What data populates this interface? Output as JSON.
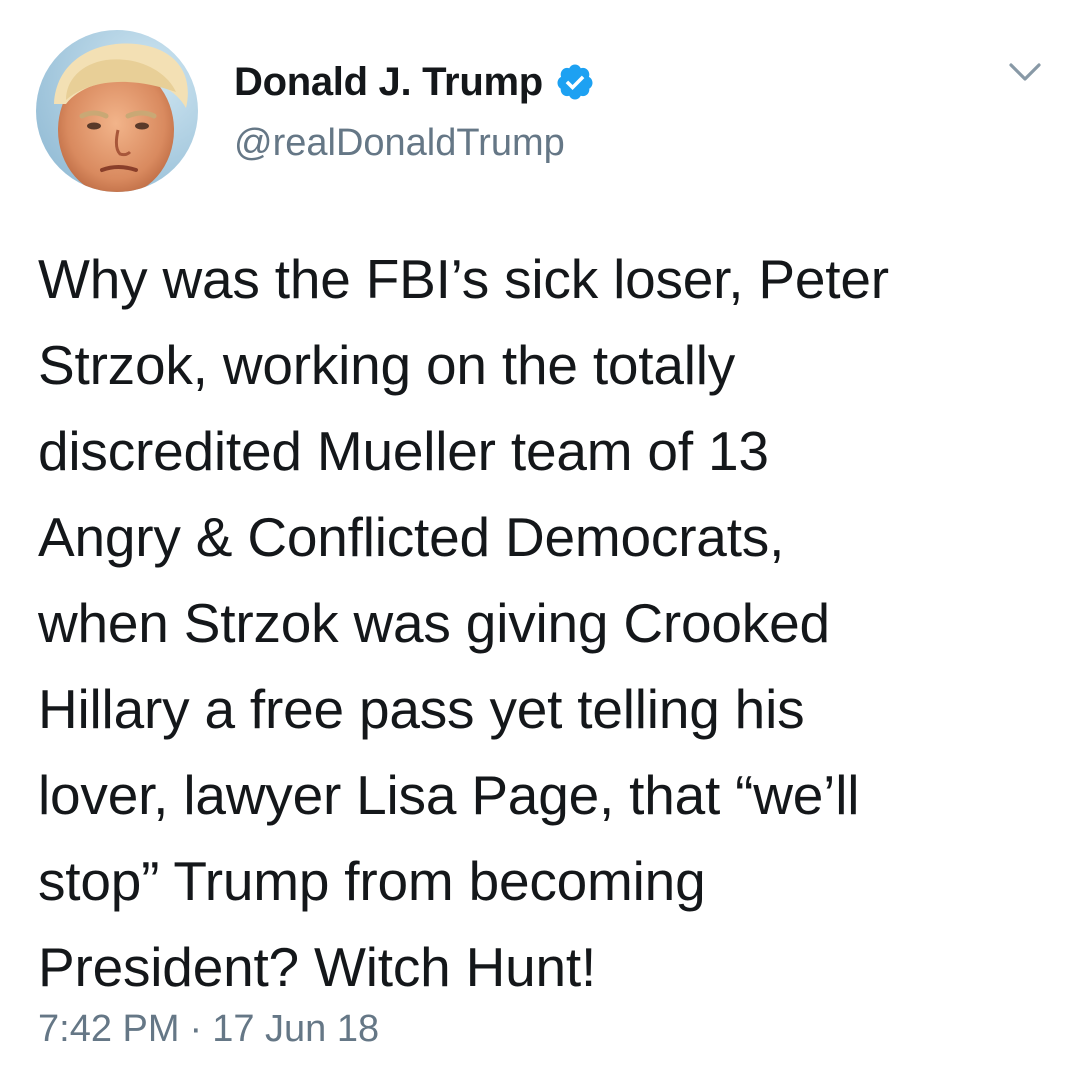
{
  "user": {
    "display_name": "Donald J. Trump",
    "handle": "@realDonaldTrump",
    "verified_icon": "verified-badge-icon",
    "avatar_icon": "profile-photo"
  },
  "tweet": {
    "lines": [
      "Why was the FBI’s sick loser, Peter",
      "Strzok, working on the totally",
      "discredited Mueller team of 13",
      "Angry & Conflicted Democrats,",
      "when Strzok was giving Crooked",
      "Hillary a free pass yet telling his",
      "lover, lawyer Lisa Page, that “we’ll",
      "stop” Trump from becoming",
      "President? Witch Hunt!"
    ],
    "time": "7:42 PM",
    "separator": "·",
    "date": "17 Jun 18"
  },
  "menu": {
    "caret_icon": "chevron-down-icon"
  },
  "colors": {
    "text": "#14171a",
    "secondary": "#657786",
    "verified": "#1da1f2",
    "background": "#ffffff"
  }
}
